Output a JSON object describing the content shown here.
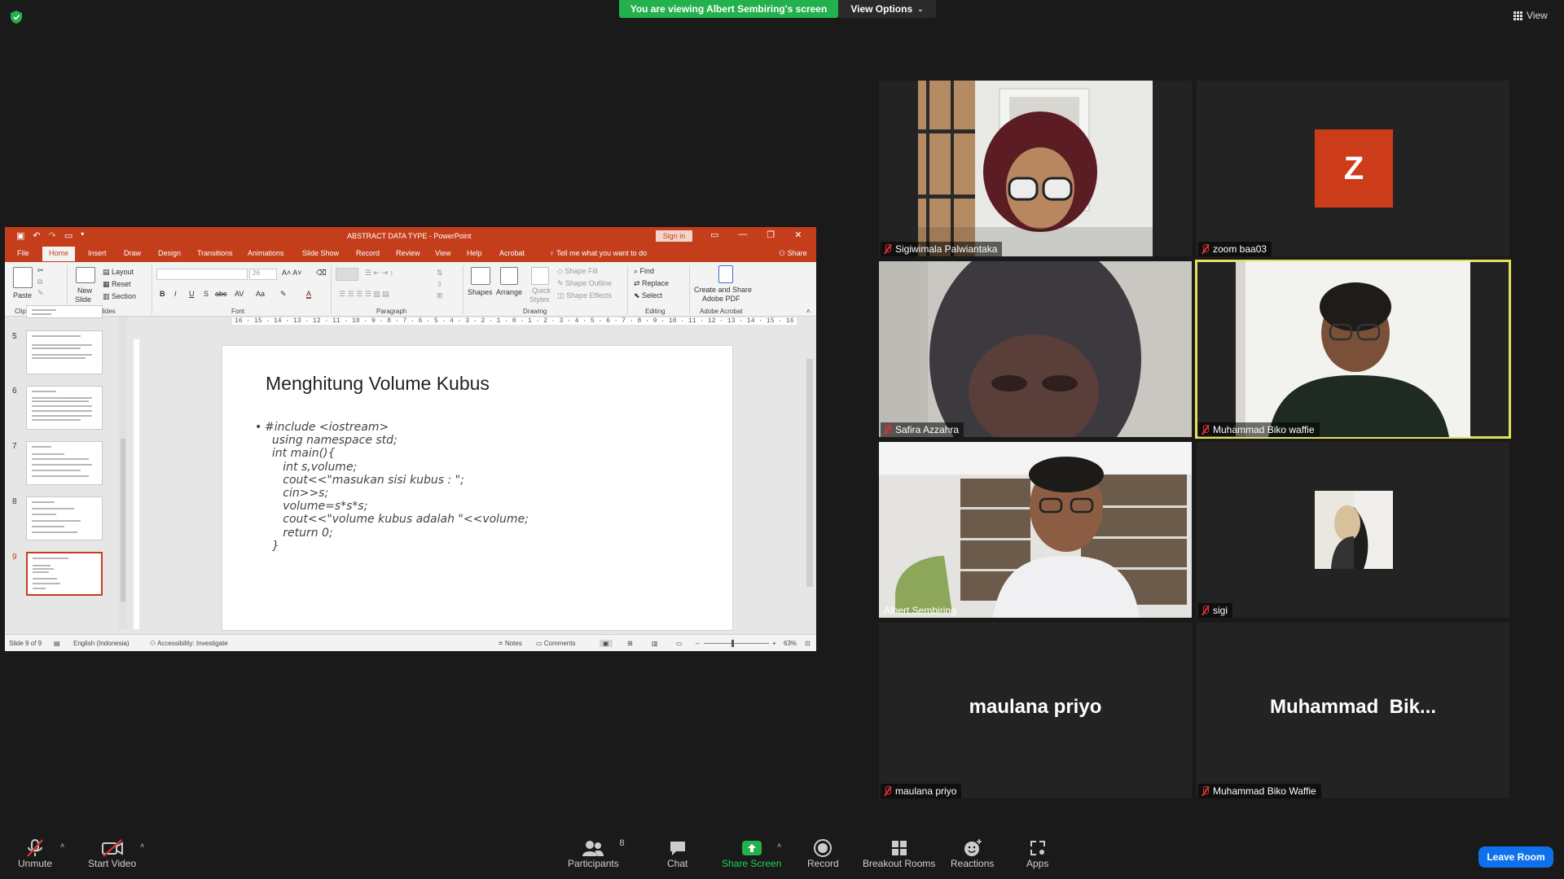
{
  "zoom": {
    "viewing_banner": "You are viewing Albert Sembiring's screen",
    "view_options": "View Options",
    "view_toggle": "View"
  },
  "ppt": {
    "title": "ABSTRACT DATA TYPE  -  PowerPoint",
    "sign_in": "Sign in",
    "tabs": [
      "File",
      "Home",
      "Insert",
      "Draw",
      "Design",
      "Transitions",
      "Animations",
      "Slide Show",
      "Record",
      "Review",
      "View",
      "Help",
      "Acrobat"
    ],
    "active_tab": "Home",
    "tell_me": "Tell me what you want to do",
    "share": "Share",
    "ribbon": {
      "paste": "Paste",
      "new_slide_1": "New",
      "new_slide_2": "Slide",
      "layout": "Layout",
      "reset": "Reset",
      "section": "Section",
      "font_size": "26",
      "shapes": "Shapes",
      "arrange": "Arrange",
      "quick_styles_1": "Quick",
      "quick_styles_2": "Styles",
      "shape_fill": "Shape Fill",
      "shape_outline": "Shape Outline",
      "shape_effects": "Shape Effects",
      "find": "Find",
      "replace": "Replace",
      "select": "Select",
      "create_share_1": "Create and Share",
      "create_share_2": "Adobe PDF",
      "groups": [
        "Clipboard",
        "Slides",
        "Font",
        "Paragraph",
        "Drawing",
        "Editing",
        "Adobe Acrobat"
      ]
    },
    "thumbnails": [
      {
        "num": "5"
      },
      {
        "num": "6"
      },
      {
        "num": "7"
      },
      {
        "num": "8"
      },
      {
        "num": "9",
        "active": true
      }
    ],
    "ruler_text": "16 · 15 · 14 · 13 · 12 · 11 · 10 · 9 · 8 · 7 · 6 · 5 · 4 · 3 · 2 · 1 · 0 · 1 · 2 · 3 · 4 · 5 · 6 · 7 · 8 · 9 · 10 · 11 · 12 · 13 · 14 · 15 · 16",
    "slide": {
      "title": "Menghitung Volume Kubus",
      "lines": [
        "#include <iostream>",
        "  using namespace std;",
        "  int main(){",
        "     int s,volume;",
        "",
        "     cout<<\"masukan sisi kubus : \";",
        "     cin>>s;",
        "",
        "     volume=s*s*s;",
        "     cout<<\"volume kubus adalah \"<<volume;",
        "     return 0;",
        "",
        "  }"
      ]
    },
    "status": {
      "slide_count": "Slide 9 of 9",
      "language": "English (Indonesia)",
      "accessibility": "Accessibility: Investigate",
      "notes": "Notes",
      "comments": "Comments",
      "zoom": "63%"
    }
  },
  "participants": [
    {
      "name": "Sigiwimala Palwiantaka",
      "type": "video",
      "muted": true
    },
    {
      "name": "zoom baa03",
      "type": "avatar",
      "initial": "Z",
      "muted": true
    },
    {
      "name": "Safira Azzahra",
      "type": "video",
      "muted": true
    },
    {
      "name": "Muhammad Biko waffie",
      "type": "video",
      "muted": true,
      "speaking": true
    },
    {
      "name": "Albert Sembiring",
      "type": "video",
      "muted": false
    },
    {
      "name": "sigi",
      "type": "image",
      "muted": true
    },
    {
      "name": "maulana priyo",
      "display": "maulana priyo",
      "type": "name",
      "muted": true
    },
    {
      "name": "Muhammad Biko Waffie",
      "display": "Muhammad  Bik...",
      "type": "name",
      "muted": true
    }
  ],
  "controls": {
    "unmute": "Unmute",
    "start_video": "Start Video",
    "participants": "Participants",
    "participants_count": "8",
    "chat": "Chat",
    "share_screen": "Share Screen",
    "record": "Record",
    "breakout_rooms": "Breakout Rooms",
    "reactions": "Reactions",
    "apps": "Apps",
    "leave": "Leave Room"
  },
  "colors": {
    "zoom_green": "#23b14d",
    "ppt_accent": "#c43e1c",
    "leave_blue": "#0e71eb",
    "speaking_outline": "#e2e15c",
    "muted_red": "#e0332f"
  }
}
